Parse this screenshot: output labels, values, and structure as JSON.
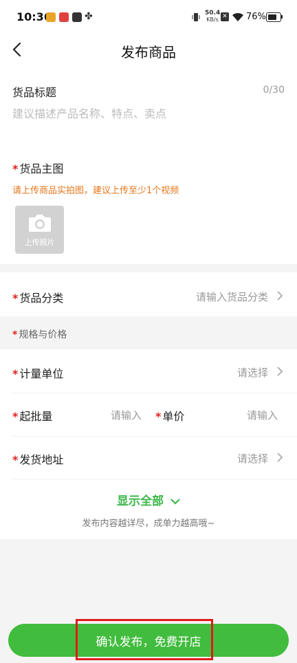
{
  "status_bar": {
    "time": "10:36",
    "net_speed_value": "50.4",
    "net_speed_unit": "KB/s",
    "battery": "76%"
  },
  "header": {
    "title": "发布商品"
  },
  "form": {
    "title_label": "货品标题",
    "title_counter": "0/30",
    "title_placeholder": "建议描述产品名称、特点、卖点",
    "image_label": "货品主图",
    "image_hint": "请上传商品实拍图，建议上传至少1个视频",
    "upload_label": "上传照片",
    "category_label": "货品分类",
    "category_placeholder": "请输入货品分类",
    "spec_section_label": "规格与价格",
    "unit_label": "计量单位",
    "unit_value": "请选择",
    "min_qty_label": "起批量",
    "min_qty_placeholder": "请输入",
    "price_label": "单价",
    "price_placeholder": "请输入",
    "address_label": "发货地址",
    "address_value": "请选择",
    "required_mark": "*",
    "show_all_label": "显示全部",
    "tip_text": "发布内容越详尽，成单力越高哦~"
  },
  "footer": {
    "confirm_label": "确认发布，免费开店"
  },
  "colors": {
    "accent_green": "#42bc3e",
    "required_red": "#e02020",
    "hint_orange": "#e5761b",
    "highlight_red": "#e01a1a"
  }
}
